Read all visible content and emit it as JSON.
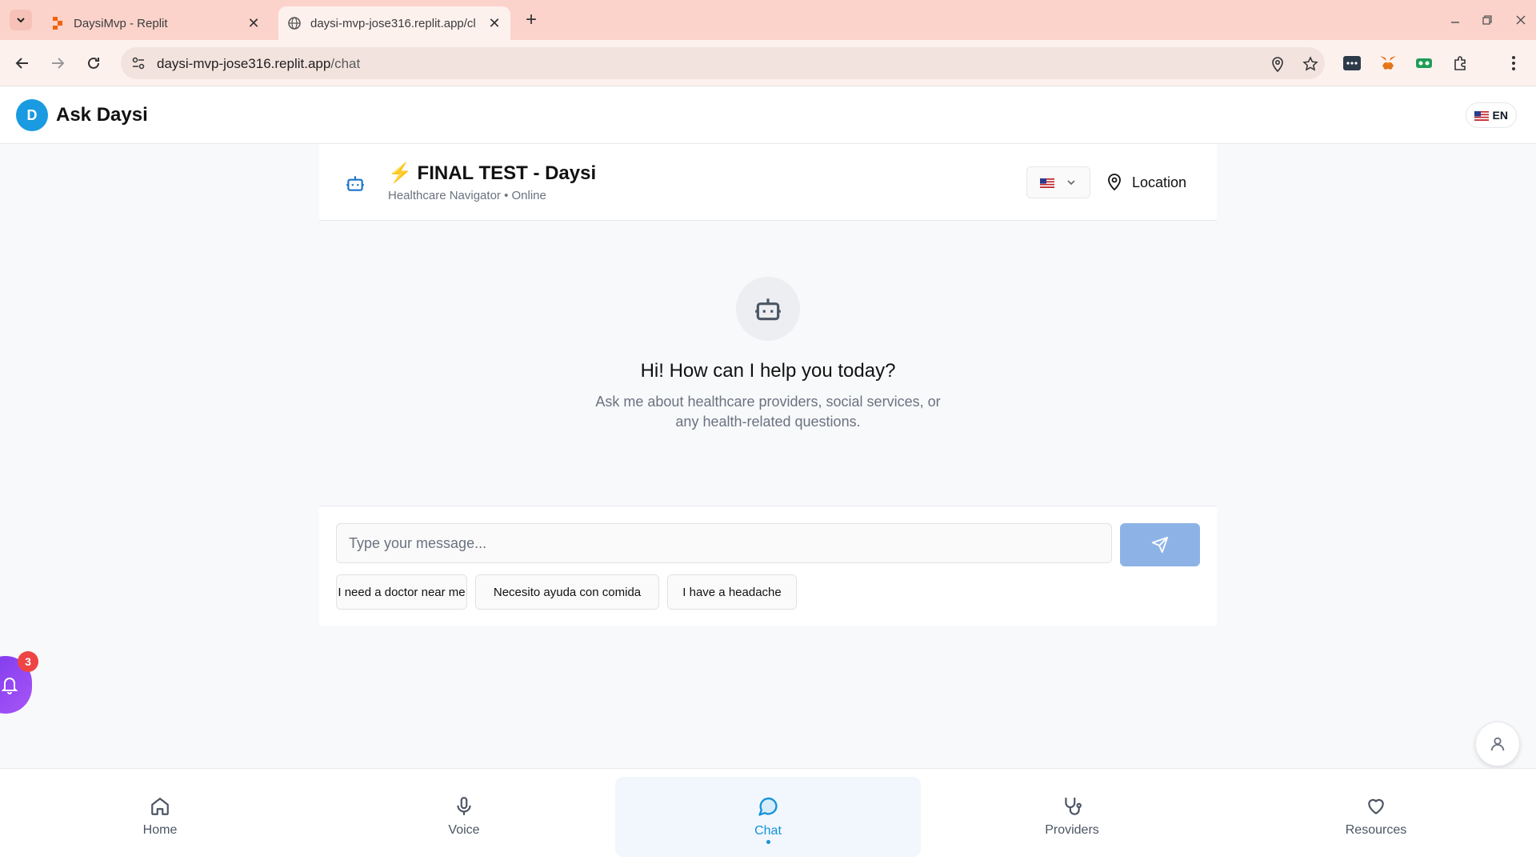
{
  "browser": {
    "tabs": [
      {
        "title": "DaysiMvp - Replit",
        "favicon": "replit-icon",
        "active": false
      },
      {
        "title": "daysi-mvp-jose316.replit.app/cl",
        "favicon": "globe-icon",
        "active": true
      }
    ],
    "url_host": "daysi-mvp-jose316.replit.app",
    "url_path": "/chat"
  },
  "header": {
    "avatar_letter": "D",
    "title": "Ask Daysi",
    "language_label": "EN"
  },
  "chat": {
    "bot_name": "⚡ FINAL TEST - Daysi",
    "bot_subtitle": "Healthcare Navigator • Online",
    "location_label": "Location",
    "greeting": "Hi! How can I help you today?",
    "greeting_sub": "Ask me about healthcare providers, social services, or any health-related questions.",
    "input_placeholder": "Type your message...",
    "suggestions": [
      "I need a doctor near me",
      "Necesito ayuda con comida",
      "I have a headache"
    ]
  },
  "notifications": {
    "count": "3"
  },
  "bottom_nav": [
    {
      "label": "Home",
      "icon": "home-icon",
      "active": false
    },
    {
      "label": "Voice",
      "icon": "microphone-icon",
      "active": false
    },
    {
      "label": "Chat",
      "icon": "chat-bubble-icon",
      "active": true
    },
    {
      "label": "Providers",
      "icon": "stethoscope-icon",
      "active": false
    },
    {
      "label": "Resources",
      "icon": "heart-icon",
      "active": false
    }
  ],
  "colors": {
    "tabbar": "#fbd3cb",
    "accent": "#1592d9",
    "send_button": "#8db3e6",
    "badge": "#ef4444",
    "fab": "#8b5cf6"
  }
}
